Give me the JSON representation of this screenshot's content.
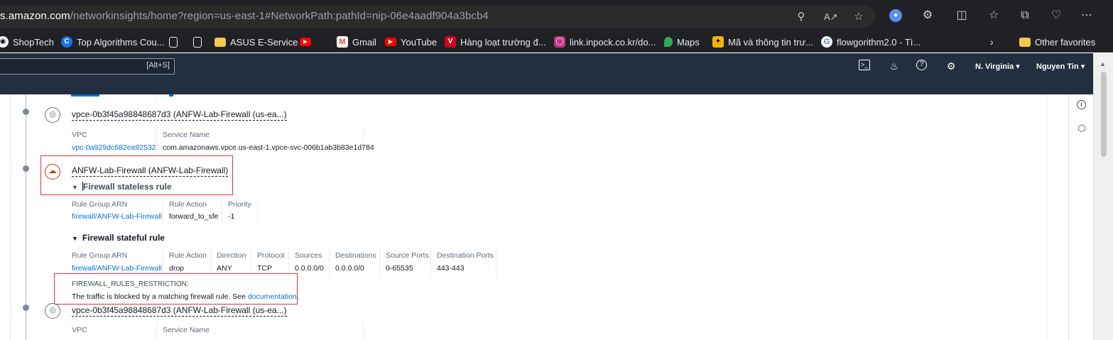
{
  "browser": {
    "url_host": "s.amazon.com",
    "url_path": "/networkinsights/home?region=us-east-1#NetworkPath:pathId=nip-06e4aadf904a3bcb4",
    "bookmarks": [
      {
        "label": "ShopTech",
        "icon": "github-icon",
        "color": "#333333"
      },
      {
        "label": "Top Algorithms Cou...",
        "icon": "c-logo-icon",
        "color": "#1a73e8"
      },
      {
        "label": "",
        "icon": "document-icon",
        "color": "#202124"
      },
      {
        "label": "",
        "icon": "document-icon",
        "color": "#202124"
      },
      {
        "label": "ASUS E-Service",
        "icon": "folder-icon",
        "color": "#f2c94c"
      },
      {
        "label": "",
        "icon": "youtube-icon",
        "color": "#ff0000"
      },
      {
        "label": "Gmail",
        "icon": "gmail-icon",
        "color": "#ea4335"
      },
      {
        "label": "YouTube",
        "icon": "youtube-icon",
        "color": "#ff0000"
      },
      {
        "label": "Hàng loạt trường đ...",
        "icon": "v-logo-icon",
        "color": "#d0021b"
      },
      {
        "label": "link.inpock.co.kr/do...",
        "icon": "instagram-icon",
        "color": "#c13584"
      },
      {
        "label": "Maps",
        "icon": "maps-pin-icon",
        "color": "#34a853"
      },
      {
        "label": "Mã và thông tin trư...",
        "icon": "badge-icon",
        "color": "#f4b400"
      },
      {
        "label": "flowgorithm2.0 - Tì...",
        "icon": "google-icon",
        "color": "#4285f4"
      }
    ],
    "other_favorites": "Other favorites"
  },
  "aws": {
    "search_shortcut": "[Alt+S]",
    "region": "N. Virginia",
    "user": "Nguyen Tin"
  },
  "path": {
    "nodes": [
      {
        "title": "vpce-0b3f45a98848687d3 (ANFW-Lab-Firewall (us-ea...)",
        "vpc_label": "VPC",
        "vpc_value": "vpc-0a929dc682ea92532",
        "service_label": "Service Name",
        "service_value": "com.amazonaws.vpce.us-east-1.vpce-svc-006b1ab3b83e1d784"
      },
      {
        "title": "ANFW-Lab-Firewall (ANFW-Lab-Firewall)",
        "stateless": {
          "heading": "Firewall stateless rule",
          "headers": [
            "Rule Group ARN",
            "Rule Action",
            "Priority"
          ],
          "values": [
            "firewall/ANFW-Lab-Firewall",
            "forward_to_sfe",
            "-1"
          ]
        },
        "stateful": {
          "heading": "Firewall stateful rule",
          "headers": [
            "Rule Group ARN",
            "Rule Action",
            "Direction",
            "Protocol",
            "Sources",
            "Destinations",
            "Source Ports",
            "Destination Ports"
          ],
          "values": [
            "firewall/ANFW-Lab-Firewall",
            "drop",
            "ANY",
            "TCP",
            "0.0.0.0/0",
            "0.0.0.0/0",
            "0-65535",
            "443-443"
          ]
        },
        "restriction": {
          "code": "FIREWALL_RULES_RESTRICTION:",
          "message": "The traffic is blocked by a matching firewall rule. See",
          "link": "documentation",
          "period": "."
        }
      },
      {
        "title": "vpce-0b3f45a98848687d3 (ANFW-Lab-Firewall (us-ea...)",
        "vpc_label": "VPC",
        "service_label": "Service Name"
      }
    ]
  }
}
